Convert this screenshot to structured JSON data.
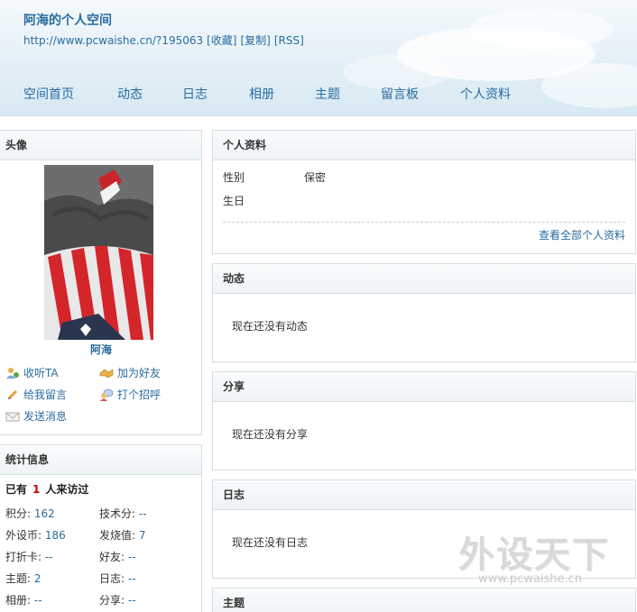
{
  "header": {
    "title": "阿海的个人空间",
    "url": "http://www.pcwaishe.cn/?195063",
    "links": [
      "[收藏]",
      "[复制]",
      "[RSS]"
    ]
  },
  "nav": [
    "空间首页",
    "动态",
    "日志",
    "相册",
    "主题",
    "留言板",
    "个人资料"
  ],
  "avatar_panel": {
    "title": "头像",
    "username": "阿海",
    "actions": [
      "收听TA",
      "加为好友",
      "给我留言",
      "打个招呼",
      "发送消息"
    ]
  },
  "stats_panel": {
    "title": "统计信息",
    "visits_prefix": "已有",
    "visits_count": "1",
    "visits_suffix": "人来访过",
    "items": [
      {
        "label": "积分:",
        "value": "162"
      },
      {
        "label": "技术分:",
        "value": "--"
      },
      {
        "label": "外设币:",
        "value": "186"
      },
      {
        "label": "发烧值:",
        "value": "7"
      },
      {
        "label": "打折卡:",
        "value": "--"
      },
      {
        "label": "好友:",
        "value": "--"
      },
      {
        "label": "主题:",
        "value": "2"
      },
      {
        "label": "日志:",
        "value": "--"
      },
      {
        "label": "相册:",
        "value": "--"
      },
      {
        "label": "分享:",
        "value": "--"
      }
    ]
  },
  "profile_panel": {
    "title": "个人资料",
    "gender_label": "性别",
    "gender_value": "保密",
    "birthday_label": "生日",
    "more_link": "查看全部个人资料"
  },
  "feed_panel": {
    "title": "动态",
    "empty": "现在还没有动态"
  },
  "share_panel": {
    "title": "分享",
    "empty": "现在还没有分享"
  },
  "blog_panel": {
    "title": "日志",
    "empty": "现在还没有日志"
  },
  "topic_panel": {
    "title": "主题"
  },
  "watermark": {
    "big": "外设天下",
    "small": "www.pcwaishe.cn"
  }
}
